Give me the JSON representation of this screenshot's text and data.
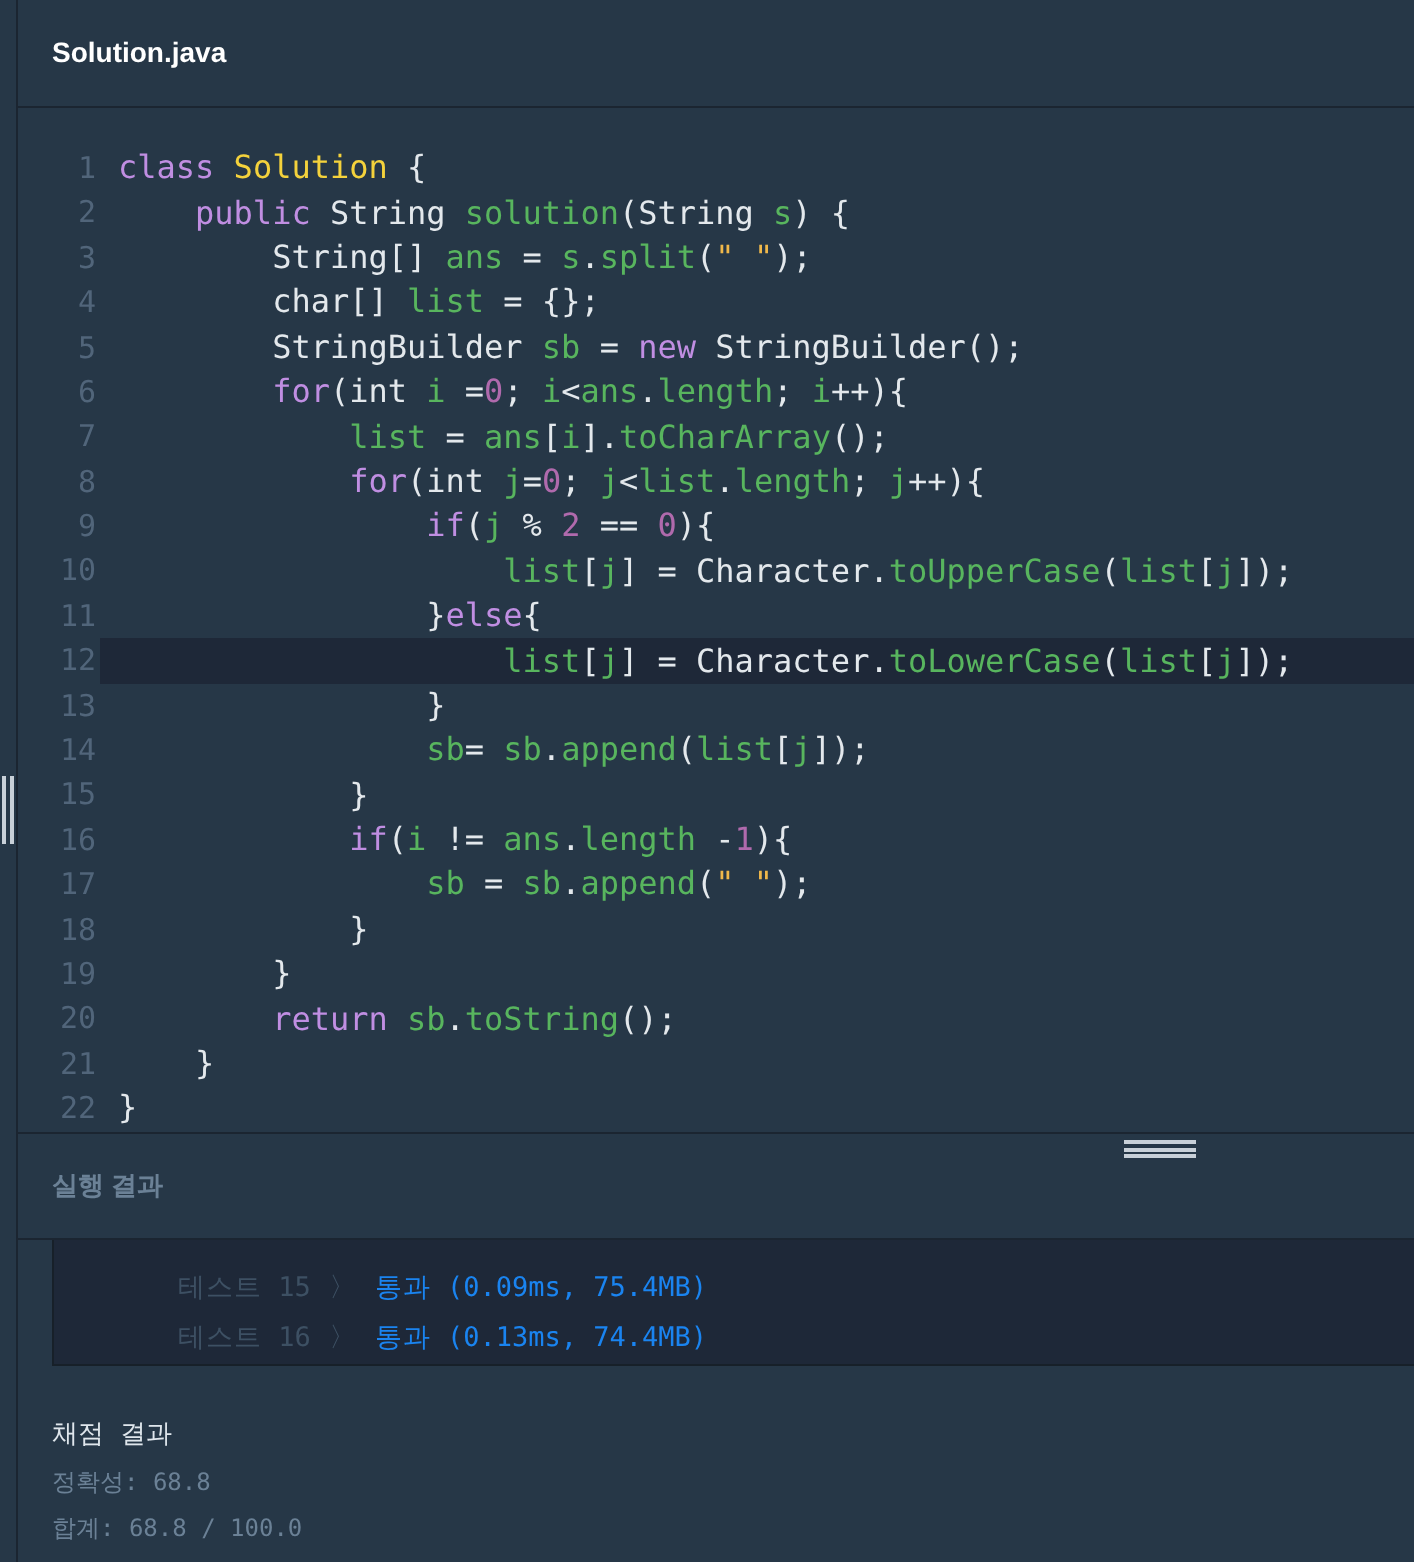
{
  "editor": {
    "filename": "Solution.java",
    "lines": [
      {
        "number": "1",
        "selected": false,
        "tokens": [
          {
            "kind": "keyword",
            "text": "class"
          },
          {
            "kind": "class",
            "text": " Solution"
          },
          {
            "kind": "plain",
            "text": " {"
          }
        ]
      },
      {
        "number": "2",
        "selected": false,
        "tokens": [
          {
            "kind": "keyword",
            "text": "    public"
          },
          {
            "kind": "plain",
            "text": " String "
          },
          {
            "kind": "ident",
            "text": "solution"
          },
          {
            "kind": "plain",
            "text": "(String "
          },
          {
            "kind": "ident",
            "text": "s"
          },
          {
            "kind": "plain",
            "text": ") {"
          }
        ]
      },
      {
        "number": "3",
        "selected": false,
        "tokens": [
          {
            "kind": "plain",
            "text": "        String[] "
          },
          {
            "kind": "ident",
            "text": "ans"
          },
          {
            "kind": "plain",
            "text": " = "
          },
          {
            "kind": "ident",
            "text": "s"
          },
          {
            "kind": "plain",
            "text": "."
          },
          {
            "kind": "ident",
            "text": "split"
          },
          {
            "kind": "plain",
            "text": "("
          },
          {
            "kind": "string",
            "text": "\" \""
          },
          {
            "kind": "plain",
            "text": ");"
          }
        ]
      },
      {
        "number": "4",
        "selected": false,
        "tokens": [
          {
            "kind": "plain",
            "text": "        char[] "
          },
          {
            "kind": "ident",
            "text": "list"
          },
          {
            "kind": "plain",
            "text": " = {};"
          }
        ]
      },
      {
        "number": "5",
        "selected": false,
        "tokens": [
          {
            "kind": "plain",
            "text": "        StringBuilder "
          },
          {
            "kind": "ident",
            "text": "sb"
          },
          {
            "kind": "plain",
            "text": " = "
          },
          {
            "kind": "keyword",
            "text": "new"
          },
          {
            "kind": "plain",
            "text": " StringBuilder();"
          }
        ]
      },
      {
        "number": "6",
        "selected": false,
        "tokens": [
          {
            "kind": "keyword",
            "text": "        for"
          },
          {
            "kind": "plain",
            "text": "(int "
          },
          {
            "kind": "ident",
            "text": "i"
          },
          {
            "kind": "plain",
            "text": " ="
          },
          {
            "kind": "number",
            "text": "0"
          },
          {
            "kind": "plain",
            "text": "; "
          },
          {
            "kind": "ident",
            "text": "i"
          },
          {
            "kind": "plain",
            "text": "<"
          },
          {
            "kind": "ident",
            "text": "ans"
          },
          {
            "kind": "plain",
            "text": "."
          },
          {
            "kind": "ident",
            "text": "length"
          },
          {
            "kind": "plain",
            "text": "; "
          },
          {
            "kind": "ident",
            "text": "i"
          },
          {
            "kind": "plain",
            "text": "++){"
          }
        ]
      },
      {
        "number": "7",
        "selected": false,
        "tokens": [
          {
            "kind": "ident",
            "text": "            list"
          },
          {
            "kind": "plain",
            "text": " = "
          },
          {
            "kind": "ident",
            "text": "ans"
          },
          {
            "kind": "plain",
            "text": "["
          },
          {
            "kind": "ident",
            "text": "i"
          },
          {
            "kind": "plain",
            "text": "]."
          },
          {
            "kind": "ident",
            "text": "toCharArray"
          },
          {
            "kind": "plain",
            "text": "();"
          }
        ]
      },
      {
        "number": "8",
        "selected": false,
        "tokens": [
          {
            "kind": "keyword",
            "text": "            for"
          },
          {
            "kind": "plain",
            "text": "(int "
          },
          {
            "kind": "ident",
            "text": "j"
          },
          {
            "kind": "plain",
            "text": "="
          },
          {
            "kind": "number",
            "text": "0"
          },
          {
            "kind": "plain",
            "text": "; "
          },
          {
            "kind": "ident",
            "text": "j"
          },
          {
            "kind": "plain",
            "text": "<"
          },
          {
            "kind": "ident",
            "text": "list"
          },
          {
            "kind": "plain",
            "text": "."
          },
          {
            "kind": "ident",
            "text": "length"
          },
          {
            "kind": "plain",
            "text": "; "
          },
          {
            "kind": "ident",
            "text": "j"
          },
          {
            "kind": "plain",
            "text": "++){"
          }
        ]
      },
      {
        "number": "9",
        "selected": false,
        "tokens": [
          {
            "kind": "keyword",
            "text": "                if"
          },
          {
            "kind": "plain",
            "text": "("
          },
          {
            "kind": "ident",
            "text": "j"
          },
          {
            "kind": "plain",
            "text": " % "
          },
          {
            "kind": "number",
            "text": "2"
          },
          {
            "kind": "plain",
            "text": " == "
          },
          {
            "kind": "number",
            "text": "0"
          },
          {
            "kind": "plain",
            "text": "){"
          }
        ]
      },
      {
        "number": "10",
        "selected": false,
        "tokens": [
          {
            "kind": "ident",
            "text": "                    list"
          },
          {
            "kind": "plain",
            "text": "["
          },
          {
            "kind": "ident",
            "text": "j"
          },
          {
            "kind": "plain",
            "text": "] = Character."
          },
          {
            "kind": "ident",
            "text": "toUpperCase"
          },
          {
            "kind": "plain",
            "text": "("
          },
          {
            "kind": "ident",
            "text": "list"
          },
          {
            "kind": "plain",
            "text": "["
          },
          {
            "kind": "ident",
            "text": "j"
          },
          {
            "kind": "plain",
            "text": "]);"
          }
        ]
      },
      {
        "number": "11",
        "selected": false,
        "tokens": [
          {
            "kind": "plain",
            "text": "                }"
          },
          {
            "kind": "keyword",
            "text": "else"
          },
          {
            "kind": "plain",
            "text": "{"
          }
        ]
      },
      {
        "number": "12",
        "selected": true,
        "tokens": [
          {
            "kind": "ident",
            "text": "                    list"
          },
          {
            "kind": "plain",
            "text": "["
          },
          {
            "kind": "ident",
            "text": "j"
          },
          {
            "kind": "plain",
            "text": "] = Character."
          },
          {
            "kind": "ident",
            "text": "toLowerCase"
          },
          {
            "kind": "plain",
            "text": "("
          },
          {
            "kind": "ident",
            "text": "list"
          },
          {
            "kind": "plain",
            "text": "["
          },
          {
            "kind": "ident",
            "text": "j"
          },
          {
            "kind": "plain",
            "text": "]);"
          }
        ]
      },
      {
        "number": "13",
        "selected": false,
        "tokens": [
          {
            "kind": "plain",
            "text": "                }"
          }
        ]
      },
      {
        "number": "14",
        "selected": false,
        "tokens": [
          {
            "kind": "ident",
            "text": "                sb"
          },
          {
            "kind": "plain",
            "text": "= "
          },
          {
            "kind": "ident",
            "text": "sb"
          },
          {
            "kind": "plain",
            "text": "."
          },
          {
            "kind": "ident",
            "text": "append"
          },
          {
            "kind": "plain",
            "text": "("
          },
          {
            "kind": "ident",
            "text": "list"
          },
          {
            "kind": "plain",
            "text": "["
          },
          {
            "kind": "ident",
            "text": "j"
          },
          {
            "kind": "plain",
            "text": "]);"
          }
        ]
      },
      {
        "number": "15",
        "selected": false,
        "tokens": [
          {
            "kind": "plain",
            "text": "            }"
          }
        ]
      },
      {
        "number": "16",
        "selected": false,
        "tokens": [
          {
            "kind": "keyword",
            "text": "            if"
          },
          {
            "kind": "plain",
            "text": "("
          },
          {
            "kind": "ident",
            "text": "i"
          },
          {
            "kind": "plain",
            "text": " != "
          },
          {
            "kind": "ident",
            "text": "ans"
          },
          {
            "kind": "plain",
            "text": "."
          },
          {
            "kind": "ident",
            "text": "length"
          },
          {
            "kind": "plain",
            "text": " -"
          },
          {
            "kind": "number",
            "text": "1"
          },
          {
            "kind": "plain",
            "text": "){"
          }
        ]
      },
      {
        "number": "17",
        "selected": false,
        "tokens": [
          {
            "kind": "ident",
            "text": "                sb"
          },
          {
            "kind": "plain",
            "text": " = "
          },
          {
            "kind": "ident",
            "text": "sb"
          },
          {
            "kind": "plain",
            "text": "."
          },
          {
            "kind": "ident",
            "text": "append"
          },
          {
            "kind": "plain",
            "text": "("
          },
          {
            "kind": "string",
            "text": "\" \""
          },
          {
            "kind": "plain",
            "text": ");"
          }
        ]
      },
      {
        "number": "18",
        "selected": false,
        "tokens": [
          {
            "kind": "plain",
            "text": "            }"
          }
        ]
      },
      {
        "number": "19",
        "selected": false,
        "tokens": [
          {
            "kind": "plain",
            "text": "        }"
          }
        ]
      },
      {
        "number": "20",
        "selected": false,
        "tokens": [
          {
            "kind": "keyword",
            "text": "        return"
          },
          {
            "kind": "ident",
            "text": " sb"
          },
          {
            "kind": "plain",
            "text": "."
          },
          {
            "kind": "ident",
            "text": "toString"
          },
          {
            "kind": "plain",
            "text": "();"
          }
        ]
      },
      {
        "number": "21",
        "selected": false,
        "tokens": [
          {
            "kind": "plain",
            "text": "    }"
          }
        ]
      },
      {
        "number": "22",
        "selected": false,
        "tokens": [
          {
            "kind": "plain",
            "text": "}"
          }
        ]
      }
    ]
  },
  "run_results": {
    "title": "실행 결과",
    "tests": [
      {
        "label": "테스트 15",
        "arrow": "〉",
        "result": "통과 (0.09ms, 75.4MB)"
      },
      {
        "label": "테스트 16",
        "arrow": "〉",
        "result": "통과 (0.13ms, 74.4MB)"
      }
    ]
  },
  "grading": {
    "title": "채점 결과",
    "accuracy": "정확성: 68.8",
    "total": "합계: 68.8 / 100.0"
  }
}
